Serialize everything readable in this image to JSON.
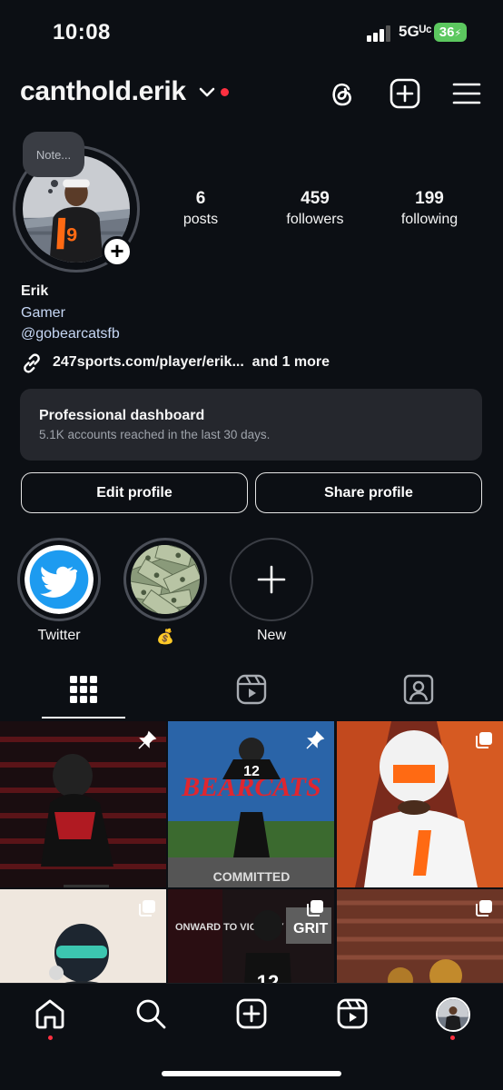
{
  "status_bar": {
    "time": "10:08",
    "network": "5Gᵁᶜ",
    "battery": "36"
  },
  "header": {
    "username": "canthold.erik"
  },
  "profile": {
    "note_placeholder": "Note...",
    "stats": [
      {
        "value": "6",
        "label": "posts"
      },
      {
        "value": "459",
        "label": "followers"
      },
      {
        "value": "199",
        "label": "following"
      }
    ],
    "name": "Erik",
    "bio": "Gamer",
    "mention": "@gobearcatsfb",
    "link": "247sports.com/player/erik...",
    "link_more": "and 1 more"
  },
  "dashboard": {
    "title": "Professional dashboard",
    "subtitle": "5.1K accounts reached in the last 30 days."
  },
  "buttons": {
    "edit": "Edit profile",
    "share": "Share profile"
  },
  "highlights": [
    {
      "label": "Twitter",
      "icon": "twitter-bird-icon"
    },
    {
      "label": "💰",
      "icon": "money-bag-icon"
    },
    {
      "label": "New",
      "icon": "plus-icon"
    }
  ],
  "tabs": [
    "grid-icon",
    "reels-icon",
    "tagged-icon"
  ],
  "accent": "#ff3040"
}
